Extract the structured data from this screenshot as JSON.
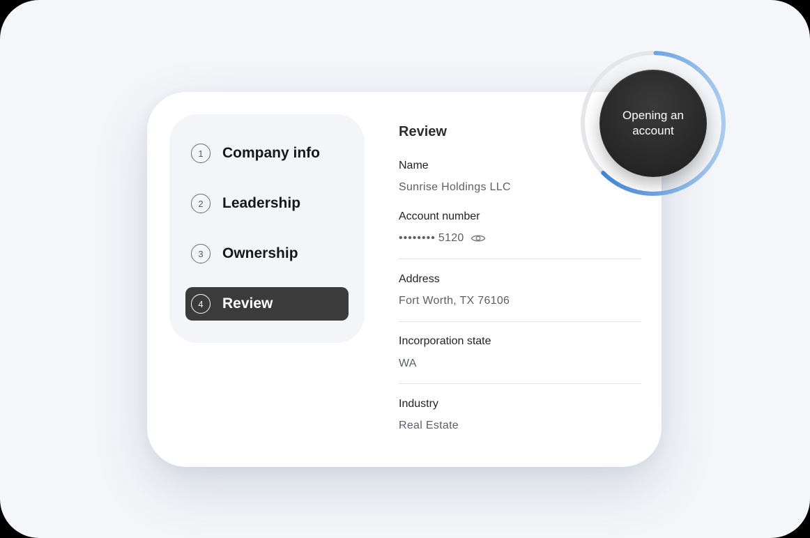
{
  "steps": [
    {
      "number": "1",
      "label": "Company info",
      "active": false
    },
    {
      "number": "2",
      "label": "Leadership",
      "active": false
    },
    {
      "number": "3",
      "label": "Ownership",
      "active": false
    },
    {
      "number": "4",
      "label": "Review",
      "active": true
    }
  ],
  "review": {
    "title": "Review",
    "fields": {
      "name": {
        "label": "Name",
        "value": "Sunrise Holdings LLC"
      },
      "account": {
        "label": "Account number",
        "masked": "••••••••",
        "last4": "5120"
      },
      "address": {
        "label": "Address",
        "value": "Fort Worth, TX 76106"
      },
      "state": {
        "label": "Incorporation state",
        "value": "WA"
      },
      "industry": {
        "label": "Industry",
        "value": "Real Estate"
      }
    }
  },
  "badge": {
    "text": "Opening an account",
    "progress": 0.62,
    "colors": {
      "accent": "#2f7bd4",
      "track": "#e4e6ea"
    }
  },
  "icons": {
    "reveal": "eye-icon"
  }
}
